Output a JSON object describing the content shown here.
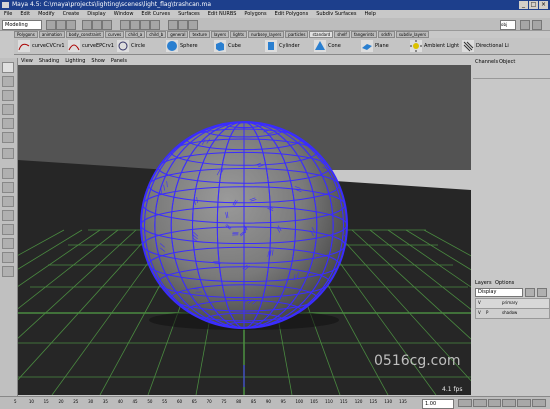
{
  "window": {
    "title": "Maya 4.5: C:\\maya\\projects\\lighting\\scenes\\light_flag\\trashcan.ma",
    "buttons": [
      "_",
      "□",
      "×"
    ]
  },
  "menubar": [
    "File",
    "Edit",
    "Modify",
    "Create",
    "Display",
    "Window",
    "Edit Curves",
    "Surfaces",
    "Edit NURBS",
    "Polygons",
    "Edit Polygons",
    "Subdiv Surfaces",
    "Help"
  ],
  "status": {
    "mode": "Modeling",
    "field": "obj"
  },
  "shelf_tabs": [
    "Polygons",
    "animation",
    "body_constraint",
    "curves",
    "child_a",
    "child_b",
    "general",
    "texture",
    "layers",
    "lights",
    "nurbsey_layers",
    "particles",
    "standard",
    "shelf",
    "fangerints",
    "sdsfn",
    "subdiv_layers"
  ],
  "shelf_items": [
    {
      "label": "curveCVCrv1",
      "icon": "curve-cv-icon"
    },
    {
      "label": "curveEPCrv1",
      "icon": "curve-ep-icon"
    },
    {
      "label": "Circle",
      "icon": "circle-icon"
    },
    {
      "label": "Sphere",
      "icon": "sphere-icon"
    },
    {
      "label": "Cube",
      "icon": "cube-icon"
    },
    {
      "label": "Cylinder",
      "icon": "cylinder-icon"
    },
    {
      "label": "Cone",
      "icon": "cone-icon"
    },
    {
      "label": "Plane",
      "icon": "plane-icon"
    },
    {
      "label": "Ambient Light",
      "icon": "ambient-light-icon"
    },
    {
      "label": "Directional Li",
      "icon": "directional-light-icon"
    }
  ],
  "panel_menu": [
    "View",
    "Shading",
    "Lighting",
    "Show",
    "Panels"
  ],
  "viewport": {
    "fps": "4.1 fps",
    "watermark": "0516cg.com",
    "colors": {
      "sky": "#505050",
      "floor": "#262626",
      "sphere_wire": "#3a2cff",
      "grid": "#4a8a40"
    }
  },
  "channel_box": {
    "tabs": [
      "Channels",
      "Object"
    ]
  },
  "layers": {
    "tabs": [
      "Layers",
      "Options"
    ],
    "dropdown": "Display",
    "rows": [
      {
        "v": "V",
        "p": "",
        "name": "primary"
      },
      {
        "v": "V",
        "p": "P",
        "name": "shadow"
      }
    ]
  },
  "timeline": {
    "ticks": [
      "5",
      "10",
      "15",
      "20",
      "25",
      "30",
      "35",
      "40",
      "45",
      "50",
      "55",
      "60",
      "65",
      "70",
      "75",
      "80",
      "85",
      "90",
      "95",
      "100",
      "105",
      "110",
      "115",
      "120",
      "125",
      "130",
      "135"
    ],
    "current": "1.00"
  }
}
